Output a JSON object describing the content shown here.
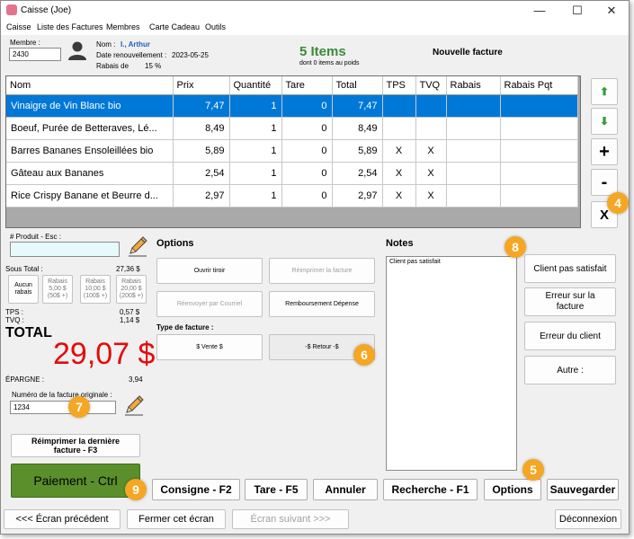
{
  "window": {
    "title": "Caisse (Joe)",
    "minimize": "—",
    "maximize": "☐",
    "close": "✕"
  },
  "menu": [
    "Caisse",
    "Liste des Factures",
    "Membres",
    "Carte Cadeau",
    "Outils"
  ],
  "member": {
    "label": "Membre :",
    "number": "2430",
    "name_label": "Nom :",
    "name": "I., Arthur",
    "renewal_label": "Date renouvellement :",
    "renewal_date": "2023-05-25",
    "discount_label": "Rabais de",
    "discount_value": "15 %"
  },
  "items_summary": {
    "count": "5 Items",
    "sub": "dont 0 items au poids"
  },
  "invoice_status": "Nouvelle facture",
  "table": {
    "headers": [
      "Nom",
      "Prix",
      "Quantité",
      "Tare",
      "Total",
      "TPS",
      "TVQ",
      "Rabais",
      "Rabais Pqt"
    ],
    "rows": [
      [
        "Vinaigre de Vin Blanc bio",
        "7,47",
        "1",
        "0",
        "7,47",
        "",
        "",
        "",
        ""
      ],
      [
        "Boeuf, Purée de Betteraves, Lé...",
        "8,49",
        "1",
        "0",
        "8,49",
        "",
        "",
        "",
        ""
      ],
      [
        "Barres Bananes Ensoleillées bio",
        "5,89",
        "1",
        "0",
        "5,89",
        "X",
        "X",
        "",
        ""
      ],
      [
        "Gâteau aux Bananes",
        "2,54",
        "1",
        "0",
        "2,54",
        "X",
        "X",
        "",
        ""
      ],
      [
        "Rice Crispy Banane et Beurre d...",
        "2,97",
        "1",
        "0",
        "2,97",
        "X",
        "X",
        "",
        ""
      ]
    ]
  },
  "side_buttons": {
    "up": "⬆",
    "down": "⬇",
    "plus": "+",
    "minus": "-",
    "remove": "X"
  },
  "product": {
    "label": "# Produit - Esc :",
    "value": ""
  },
  "totals": {
    "subtotal_label": "Sous Total :",
    "subtotal_value": "27,36 $",
    "discounts": [
      [
        "Aucun",
        "rabais",
        ""
      ],
      [
        "Rabais",
        "5,00 $",
        "(50$ +)"
      ],
      [
        "Rabais",
        "10,00 $",
        "(100$ +)"
      ],
      [
        "Rabais",
        "20,00 $",
        "(200$ +)"
      ]
    ],
    "tps_label": "TPS :",
    "tps_value": "0,57 $",
    "tvq_label": "TVQ :",
    "tvq_value": "1,14 $",
    "total_label": "TOTAL",
    "total_value": "29,07 $",
    "savings_label": "ÉPARGNE :",
    "savings_value": "3,94"
  },
  "original_invoice": {
    "label": "Numéro de la facture originale :",
    "value": "1234"
  },
  "reprint_button": "Réimprimer la dernière facture - F3",
  "payment_button": "Paiement - Ctrl",
  "options": {
    "title": "Options",
    "open_drawer": "Ouvrir tiroir",
    "reprint_invoice": "Réimprimer la facture",
    "resend_email": "Réenvoyer par Courriel",
    "refund_expense": "Remboursement Dépense",
    "invoice_type_label": "Type de facture :",
    "sale": "$ Vente $",
    "return": "-$ Retour -$"
  },
  "notes": {
    "title": "Notes",
    "text": "Client pas satisfait"
  },
  "note_buttons": [
    "Client pas satisfait",
    "Erreur sur la facture",
    "Erreur du client",
    "Autre :"
  ],
  "bottom_buttons": [
    "Consigne - F2",
    "Tare - F5",
    "Annuler",
    "Recherche - F1",
    "Options",
    "Sauvegarder"
  ],
  "nav": {
    "previous": "<<< Écran précédent",
    "close_screen": "Fermer cet écran",
    "next": "Écran suivant >>>",
    "logout": "Déconnexion"
  },
  "callouts": [
    "4",
    "5",
    "6",
    "7",
    "8",
    "9"
  ],
  "colors": {
    "selection": "#0078d7",
    "total_red": "#e30b0b",
    "items_green": "#3a8a3a",
    "payment_green": "#5a8f2c",
    "callout_orange": "#f5a623"
  }
}
